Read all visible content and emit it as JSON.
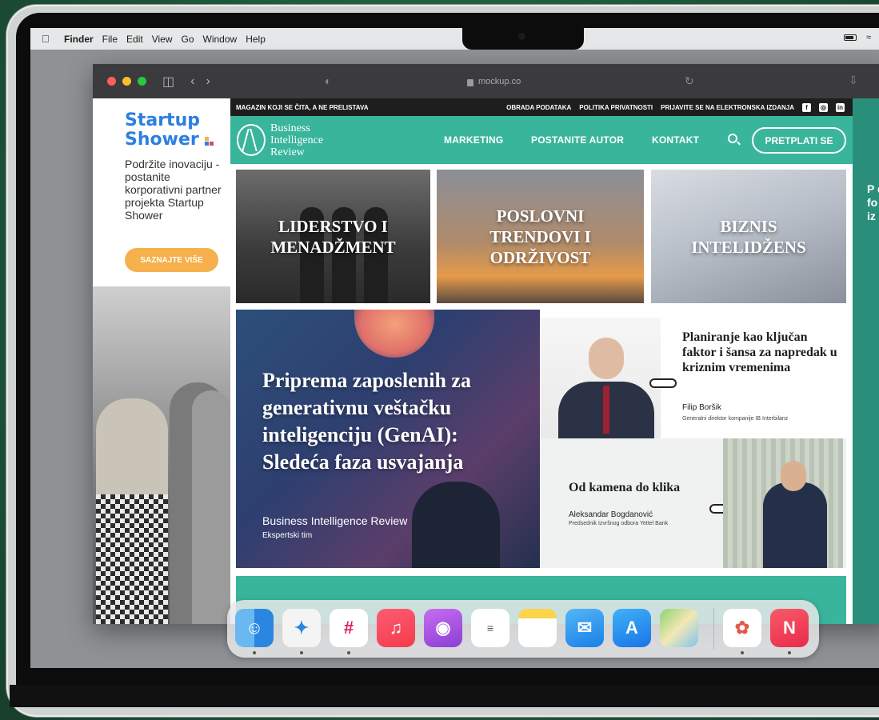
{
  "menubar": {
    "items": [
      "Finder",
      "File",
      "Edit",
      "View",
      "Go",
      "Window",
      "Help"
    ]
  },
  "browser": {
    "url": "mockup.co"
  },
  "ad": {
    "brand_line1": "Startup",
    "brand_line2": "Shower",
    "text": "Podržite inovaciju - postanite korporativni partner projekta Startup Shower",
    "button": "SAZNAJTE VIŠE",
    "colors": {
      "brand": "#2d7fe0",
      "button": "#f6b04c"
    }
  },
  "site": {
    "tagline": "MAGAZIN KOJI SE ČITA, A NE PRELISTAVA",
    "top_links": [
      "OBRADA PODATAKA",
      "POLITIKA PRIVATNOSTI",
      "PRIJAVITE SE NA ELEKTRONSKA IZDANJA"
    ],
    "social": [
      "f",
      "◎",
      "in"
    ],
    "logo": {
      "line1": "Business",
      "line2": "Intelligence",
      "line3": "Review"
    },
    "nav": [
      "MARKETING",
      "POSTANITE AUTOR",
      "KONTAKT"
    ],
    "subscribe": "PRETPLATI SE",
    "accent": "#39b59b",
    "tiles": [
      {
        "line1": "LIDERSTVO I",
        "line2": "MENADŽMENT",
        "line3": ""
      },
      {
        "line1": "POSLOVNI",
        "line2": "TRENDOVI I",
        "line3": "ODRŽIVOST"
      },
      {
        "line1": "BIZNIS",
        "line2": "INTELIDŽENS",
        "line3": ""
      }
    ],
    "hero": {
      "title": "Priprema zaposlenih za generativnu veštačku inteligenciju (GenAI): Sledeća faza usvajanja",
      "author": "Business Intelligence Review",
      "role": "Ekspertski tim"
    },
    "card1": {
      "title": "Planiranje kao ključan faktor i šansa za napredak u kriznim vremenima",
      "name": "Filip Boršik",
      "role": "Generalni direktor kompanije IB Interbilanz"
    },
    "card2": {
      "title": "Od kamena do klika",
      "name": "Aleksandar Bogdanović",
      "role": "Predsednik Izvršnog odbora Yettel Bank"
    }
  },
  "right_pane_text": "P d fo š iz",
  "dock": {
    "apps": [
      "finder-icon",
      "safari-icon",
      "slack-icon",
      "music-icon",
      "podcasts-icon",
      "reminders-icon",
      "notes-icon",
      "mail-icon",
      "app-store-icon",
      "maps-icon",
      "photos-icon",
      "news-icon"
    ]
  }
}
